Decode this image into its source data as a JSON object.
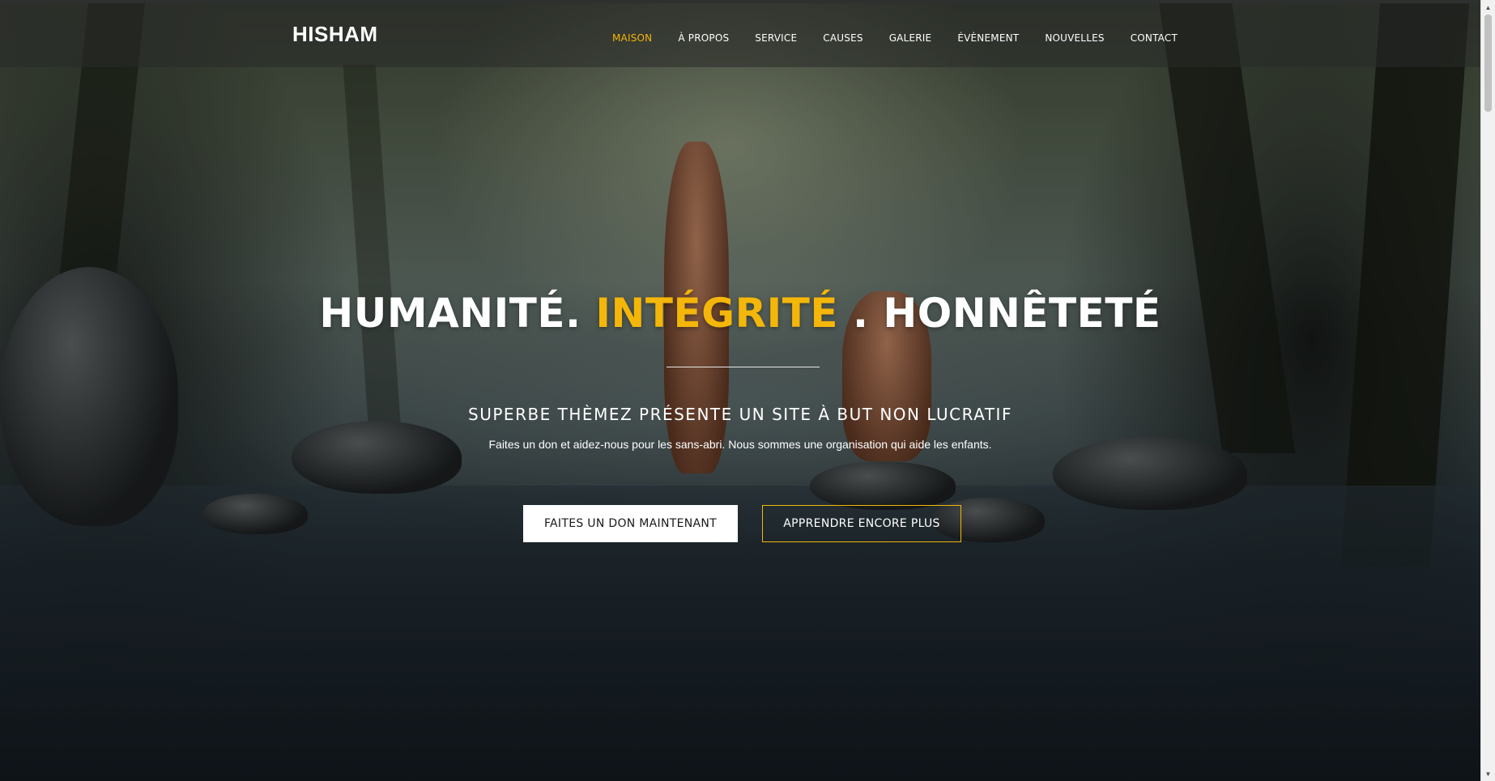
{
  "brand": {
    "name": "HISHAM"
  },
  "nav": {
    "items": [
      {
        "label": "MAISON",
        "active": true
      },
      {
        "label": "À PROPOS",
        "active": false
      },
      {
        "label": "SERVICE",
        "active": false
      },
      {
        "label": "CAUSES",
        "active": false
      },
      {
        "label": "GALERIE",
        "active": false
      },
      {
        "label": "ÉVÈNEMENT",
        "active": false
      },
      {
        "label": "NOUVELLES",
        "active": false
      },
      {
        "label": "CONTACT",
        "active": false
      }
    ]
  },
  "hero": {
    "headline_part1": "HUMANITÉ. ",
    "headline_accent": "INTÉGRITÉ",
    "headline_part2": " . HONNÊTETÉ",
    "subheadline": "SUPERBE THÈMEZ PRÉSENTE UN SITE À BUT NON LUCRATIF",
    "tagline": "Faites un don et aidez-nous pour les sans-abri. Nous sommes une organisation qui aide les enfants.",
    "primary_button": "FAITES UN DON MAINTENANT",
    "secondary_button": "APPRENDRE ENCORE PLUS"
  },
  "colors": {
    "accent": "#f4b608",
    "text": "#ffffff",
    "primary_button_bg": "#ffffff",
    "primary_button_text": "#1a1a1a"
  },
  "scrollbar": {
    "up_icon": "scroll-up-arrow-icon",
    "down_icon": "scroll-down-arrow-icon"
  }
}
